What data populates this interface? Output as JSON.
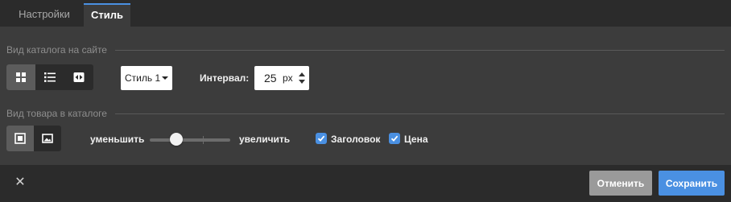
{
  "tabs": [
    {
      "label": "Настройки",
      "active": false
    },
    {
      "label": "Стиль",
      "active": true
    }
  ],
  "catalog_view": {
    "title": "Вид каталога на сайте",
    "view_buttons": [
      {
        "icon": "grid-icon",
        "active": true
      },
      {
        "icon": "list-icon",
        "active": false
      },
      {
        "icon": "carousel-icon",
        "active": false
      }
    ],
    "style_select": {
      "value": "Стиль 1"
    },
    "interval": {
      "label": "Интервал:",
      "value": "25",
      "unit": "px"
    }
  },
  "product_view": {
    "title": "Вид товара в каталоге",
    "image_buttons": [
      {
        "icon": "image-framed-icon",
        "active": true
      },
      {
        "icon": "image-full-icon",
        "active": false
      }
    ],
    "size_slider": {
      "min_label": "уменьшить",
      "max_label": "увеличить",
      "value": 0.33
    },
    "options": [
      {
        "label": "Заголовок",
        "checked": true
      },
      {
        "label": "Цена",
        "checked": true
      }
    ]
  },
  "footer": {
    "close_icon": "close-icon",
    "cancel_label": "Отменить",
    "save_label": "Сохранить"
  },
  "colors": {
    "accent": "#4a90e2",
    "panel": "#3c3c3c",
    "background": "#2b2b2b",
    "cancel_button": "#9a9a9a"
  }
}
